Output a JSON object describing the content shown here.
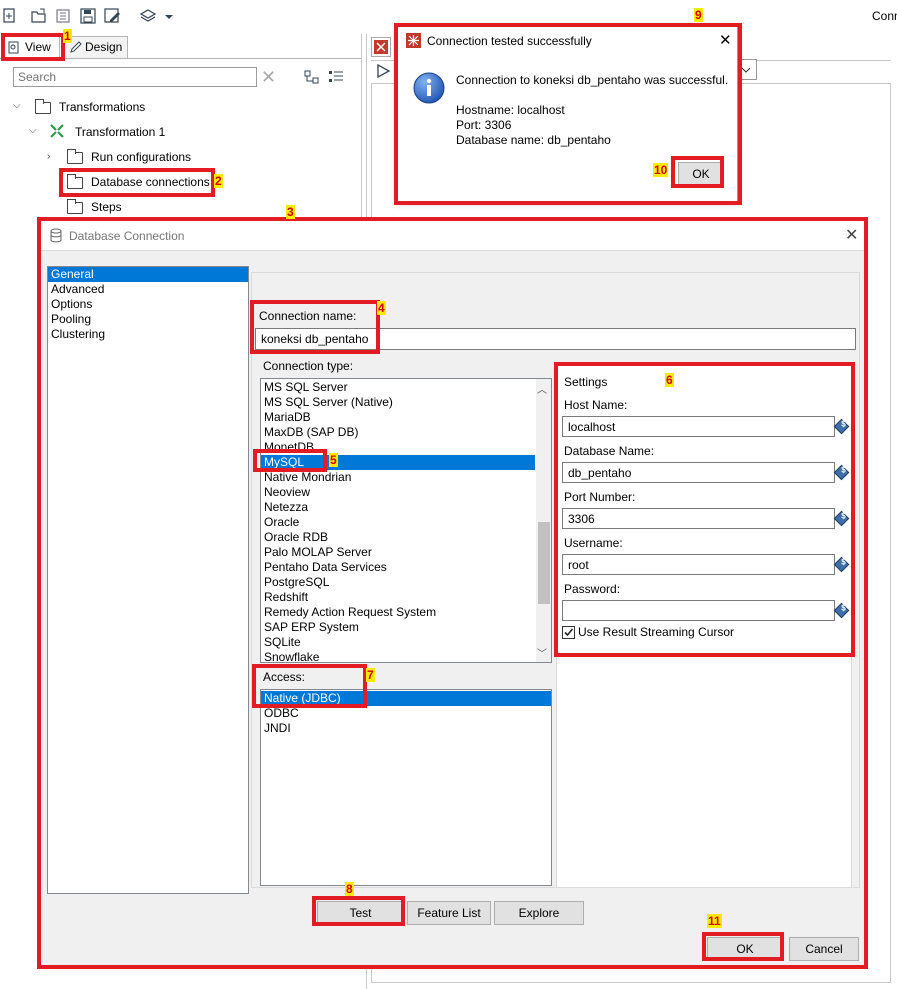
{
  "toolbar": {
    "right_text": "Conn",
    "icons": [
      "new-file-icon",
      "open-icon",
      "explore-icon",
      "save-icon",
      "save-as-icon",
      "layers-icon",
      "dropdown-arrow-icon"
    ]
  },
  "left_panel": {
    "tabs": [
      {
        "label": "View"
      },
      {
        "label": "Design"
      }
    ],
    "search_placeholder": "Search",
    "tree": {
      "transformations": "Transformations",
      "transformation1": "Transformation 1",
      "run_configurations": "Run configurations",
      "database_connections": "Database connections",
      "steps": "Steps"
    }
  },
  "message_dialog": {
    "title": "Connection tested successfully",
    "message": "Connection to koneksi db_pentaho was successful.",
    "hostname": "Hostname: localhost",
    "port": "Port: 3306",
    "database": "Database name: db_pentaho",
    "ok_label": "OK"
  },
  "db_dialog": {
    "title": "Database Connection",
    "nav": [
      "General",
      "Advanced",
      "Options",
      "Pooling",
      "Clustering"
    ],
    "nav_selected": "General",
    "connection_name_label": "Connection name:",
    "connection_name_value": "koneksi db_pentaho",
    "connection_type_label": "Connection type:",
    "connection_types": [
      "MS SQL Server",
      "MS SQL Server (Native)",
      "MariaDB",
      "MaxDB (SAP DB)",
      "MonetDB",
      "MySQL",
      "Native Mondrian",
      "Neoview",
      "Netezza",
      "Oracle",
      "Oracle RDB",
      "Palo MOLAP Server",
      "Pentaho Data Services",
      "PostgreSQL",
      "Redshift",
      "Remedy Action Request System",
      "SAP ERP System",
      "SQLite",
      "Snowflake"
    ],
    "connection_type_selected": "MySQL",
    "access_label": "Access:",
    "access_types": [
      "Native (JDBC)",
      "ODBC",
      "JNDI"
    ],
    "access_selected": "Native (JDBC)",
    "settings": {
      "title": "Settings",
      "host_label": "Host Name:",
      "host_value": "localhost",
      "database_label": "Database Name:",
      "database_value": "db_pentaho",
      "port_label": "Port Number:",
      "port_value": "3306",
      "username_label": "Username:",
      "username_value": "root",
      "password_label": "Password:",
      "password_value": "",
      "streaming_label": "Use Result Streaming Cursor",
      "streaming_checked": true
    },
    "buttons": {
      "test": "Test",
      "feature_list": "Feature List",
      "explore": "Explore",
      "ok": "OK",
      "cancel": "Cancel"
    }
  },
  "annotations": [
    "1",
    "2",
    "3",
    "4",
    "5",
    "6",
    "7",
    "8",
    "9",
    "10",
    "11"
  ],
  "colors": {
    "highlight": "#e31b23",
    "badge_bg": "#ffea00",
    "selection": "#0078d7"
  }
}
